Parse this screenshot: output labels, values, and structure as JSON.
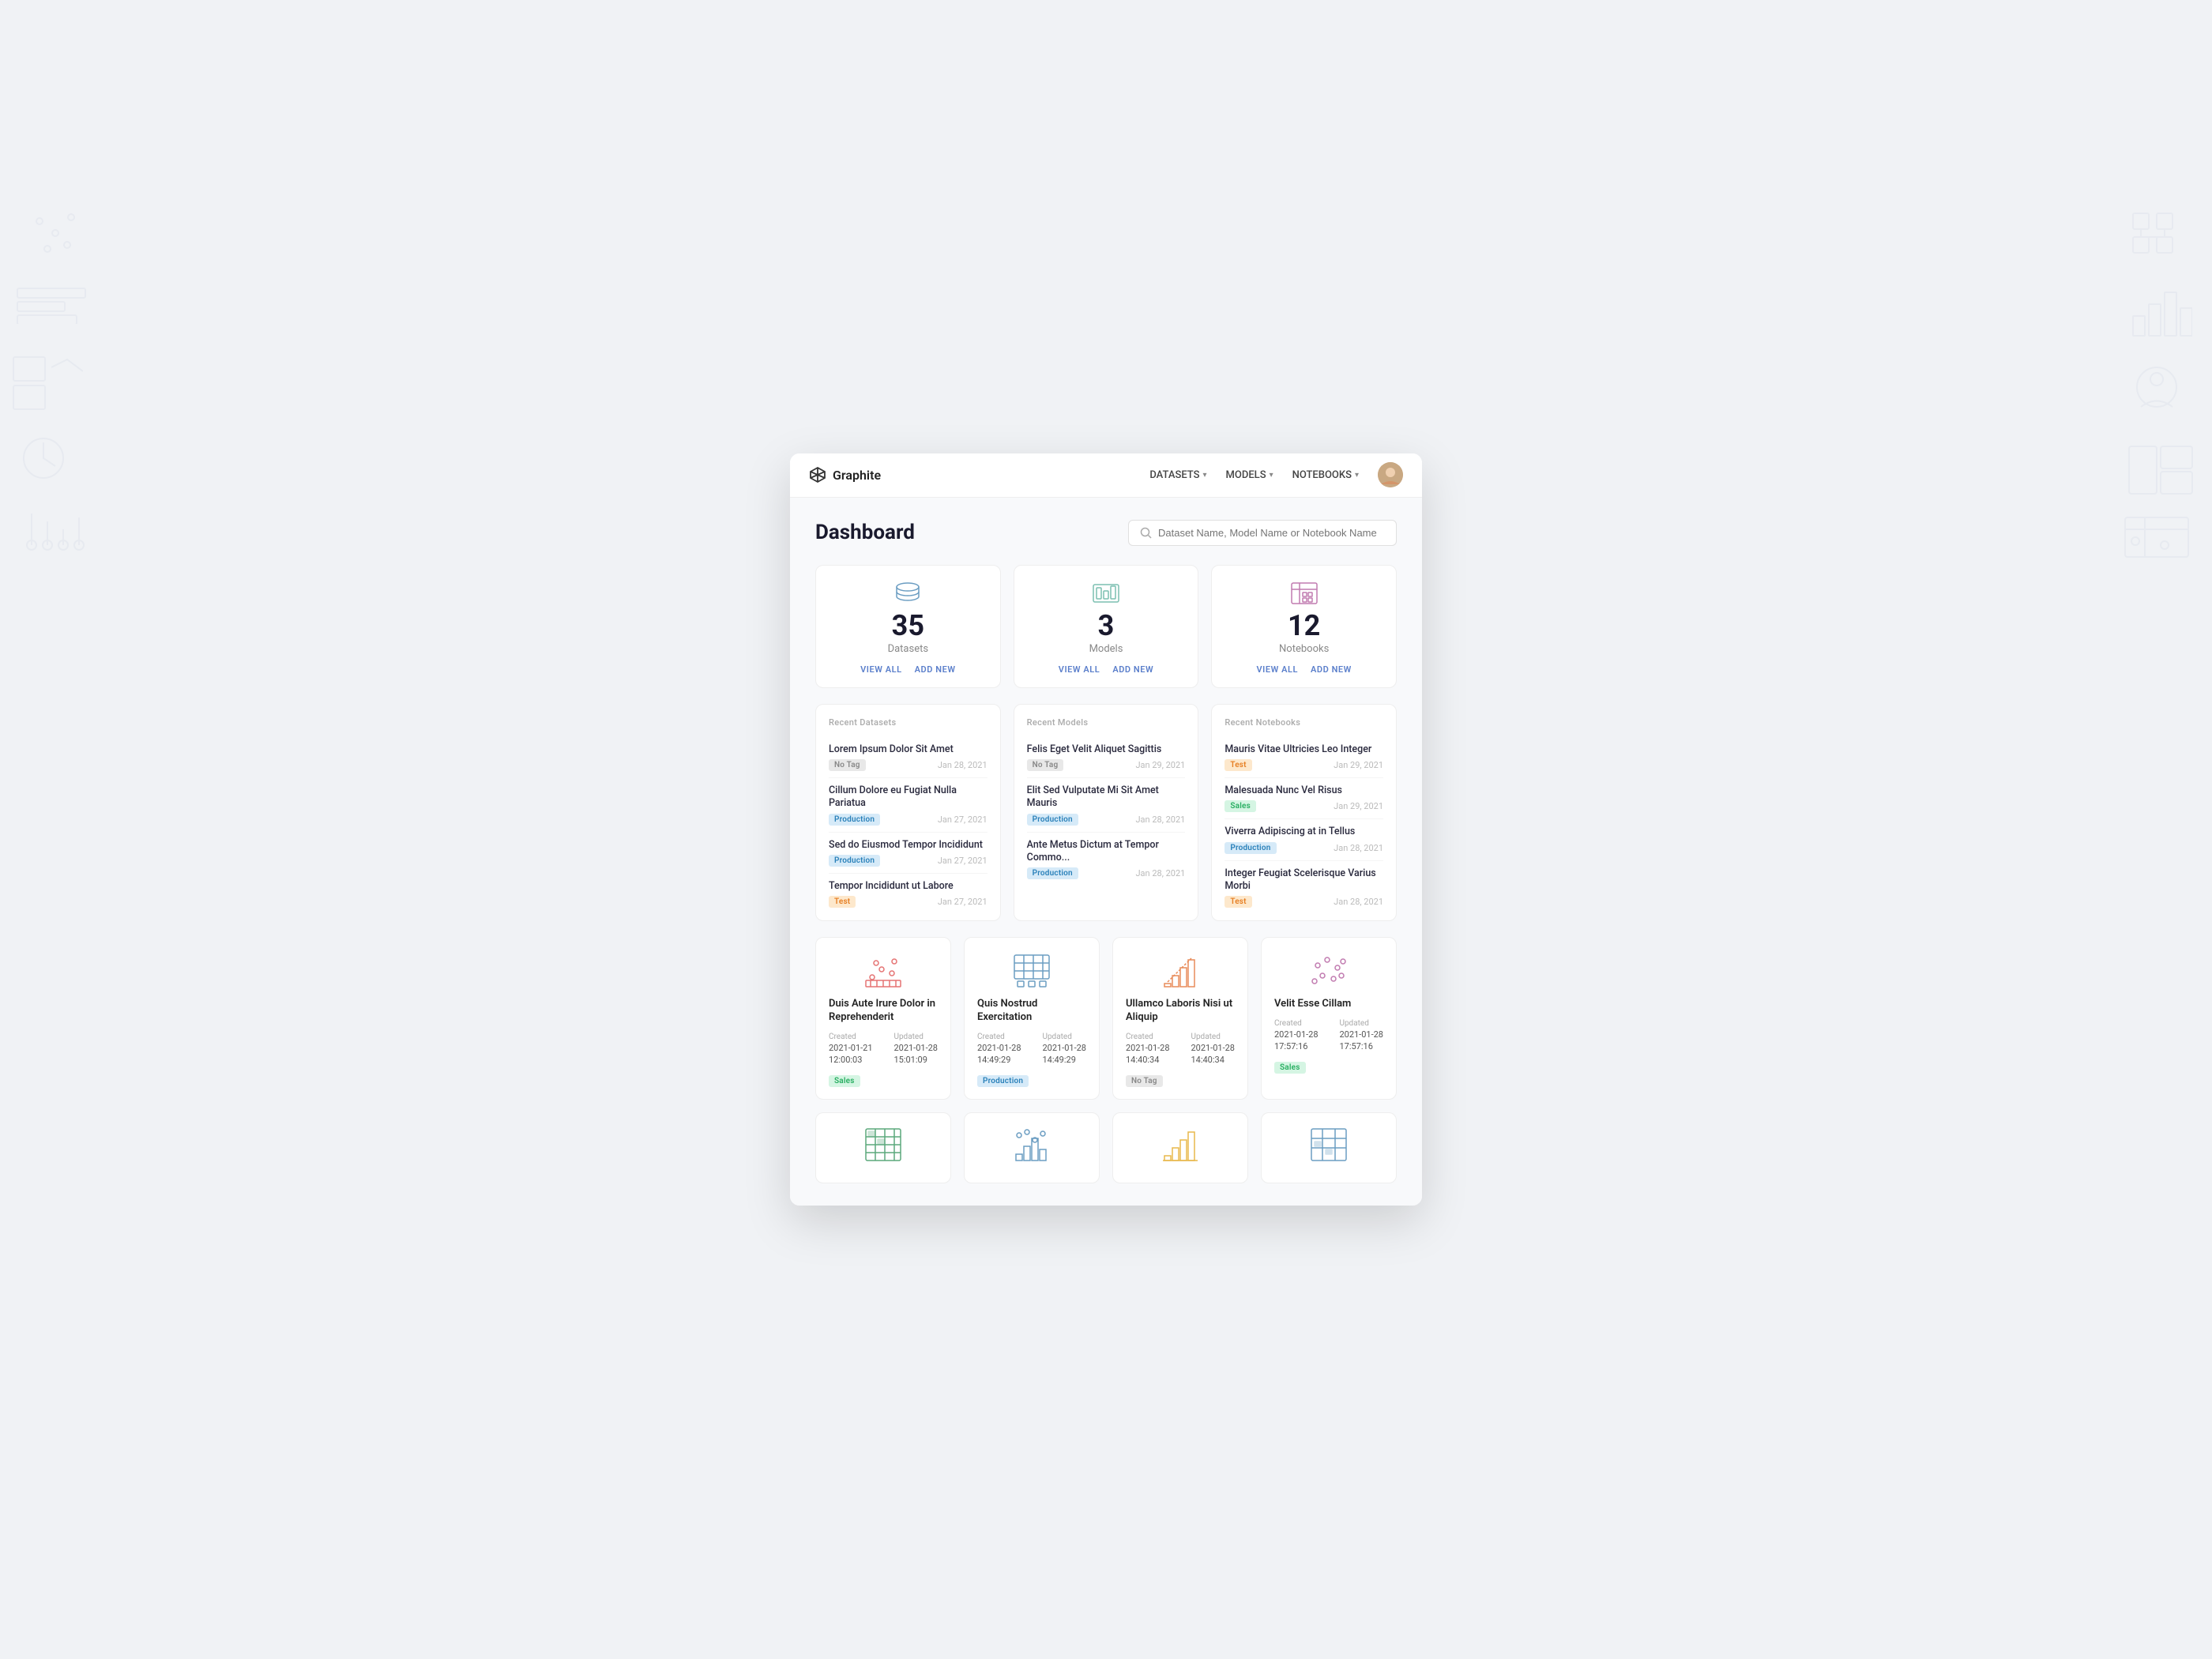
{
  "brand": {
    "name": "Graphite"
  },
  "navbar": {
    "items": [
      {
        "label": "DATASETS",
        "hasDropdown": true
      },
      {
        "label": "MODELS",
        "hasDropdown": true
      },
      {
        "label": "NOTEBOOKS",
        "hasDropdown": true
      }
    ]
  },
  "search": {
    "placeholder": "Dataset Name, Model Name or Notebook Name"
  },
  "page": {
    "title": "Dashboard"
  },
  "stats": [
    {
      "id": "datasets",
      "number": "35",
      "label": "Datasets",
      "viewAllLabel": "VIEW ALL",
      "addNewLabel": "ADD NEW",
      "iconColor": "#6b9dc2"
    },
    {
      "id": "models",
      "number": "3",
      "label": "Models",
      "viewAllLabel": "VIEW ALL",
      "addNewLabel": "ADD NEW",
      "iconColor": "#7bbfb0"
    },
    {
      "id": "notebooks",
      "number": "12",
      "label": "Notebooks",
      "viewAllLabel": "VIEW ALL",
      "addNewLabel": "ADD NEW",
      "iconColor": "#c17bb0"
    }
  ],
  "recentSections": [
    {
      "title": "Recent Datasets",
      "items": [
        {
          "name": "Lorem Ipsum Dolor Sit Amet",
          "tag": "No Tag",
          "tagType": "no-tag",
          "date": "Jan 28, 2021"
        },
        {
          "name": "Cillum Dolore eu Fugiat Nulla Pariatua",
          "tag": "Production",
          "tagType": "production",
          "date": "Jan 27, 2021"
        },
        {
          "name": "Sed do Eiusmod Tempor Incididunt",
          "tag": "Production",
          "tagType": "production",
          "date": "Jan 27, 2021"
        },
        {
          "name": "Tempor Incididunt ut Labore",
          "tag": "Test",
          "tagType": "test",
          "date": "Jan 27, 2021"
        }
      ]
    },
    {
      "title": "Recent Models",
      "items": [
        {
          "name": "Felis Eget Velit Aliquet Sagittis",
          "tag": "No Tag",
          "tagType": "no-tag",
          "date": "Jan 29, 2021"
        },
        {
          "name": "Elit Sed Vulputate Mi Sit Amet Mauris",
          "tag": "Production",
          "tagType": "production",
          "date": "Jan 28, 2021"
        },
        {
          "name": "Ante Metus Dictum at Tempor Commo...",
          "tag": "Production",
          "tagType": "production",
          "date": "Jan 28, 2021"
        }
      ]
    },
    {
      "title": "Recent Notebooks",
      "items": [
        {
          "name": "Mauris Vitae Ultricies Leo Integer",
          "tag": "Test",
          "tagType": "test",
          "date": "Jan 29, 2021"
        },
        {
          "name": "Malesuada Nunc Vel Risus",
          "tag": "Sales",
          "tagType": "sales",
          "date": "Jan 29, 2021"
        },
        {
          "name": "Viverra Adipiscing at in Tellus",
          "tag": "Production",
          "tagType": "production",
          "date": "Jan 28, 2021"
        },
        {
          "name": "Integer Feugiat Scelerisque Varius Morbi",
          "tag": "Test",
          "tagType": "test",
          "date": "Jan 28, 2021"
        }
      ]
    }
  ],
  "dataCards": [
    {
      "id": "card1",
      "title": "Duis Aute Irure Dolor in Reprehenderit",
      "created": {
        "label": "Created",
        "value": "2021-01-21\n12:00:03"
      },
      "updated": {
        "label": "Updated",
        "value": "2021-01-28\n15:01:09"
      },
      "tag": "Sales",
      "tagType": "sales",
      "iconColor": "#e57373",
      "iconType": "scatter"
    },
    {
      "id": "card2",
      "title": "Quis Nostrud Exercitation",
      "created": {
        "label": "Created",
        "value": "2021-01-28\n14:49:29"
      },
      "updated": {
        "label": "Updated",
        "value": "2021-01-28\n14:49:29"
      },
      "tag": "Production",
      "tagType": "production",
      "iconColor": "#6b9dc2",
      "iconType": "bar-table"
    },
    {
      "id": "card3",
      "title": "Ullamco Laboris Nisi ut Aliquip",
      "created": {
        "label": "Created",
        "value": "2021-01-28\n14:40:34"
      },
      "updated": {
        "label": "Updated",
        "value": "2021-01-28\n14:40:34"
      },
      "tag": "No Tag",
      "tagType": "no-tag",
      "iconColor": "#e88c5a",
      "iconType": "bar"
    },
    {
      "id": "card4",
      "title": "Velit Esse Cillam",
      "created": {
        "label": "Created",
        "value": "2021-01-28\n17:57:16"
      },
      "updated": {
        "label": "Updated",
        "value": "2021-01-28\n17:57:16"
      },
      "tag": "Sales",
      "tagType": "sales",
      "iconColor": "#c17bb0",
      "iconType": "scatter-dots"
    }
  ],
  "dataCards2": [
    {
      "iconColor": "#5ba87c",
      "iconType": "grid"
    },
    {
      "iconColor": "#6b9dc2",
      "iconType": "bar-dots"
    },
    {
      "iconColor": "#e8b84b",
      "iconType": "bar-outline"
    },
    {
      "iconColor": "#6b9dc2",
      "iconType": "bar-table2"
    }
  ]
}
